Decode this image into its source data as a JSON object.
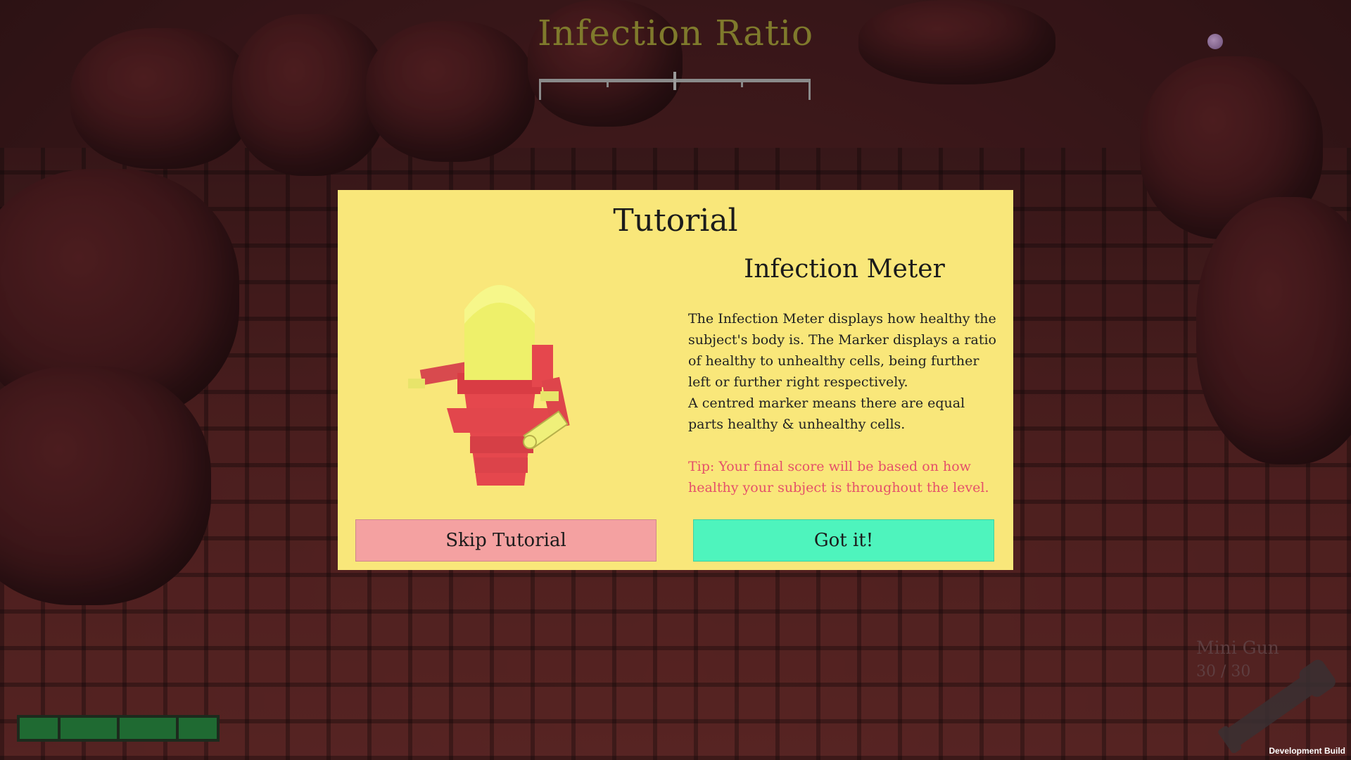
{
  "hud": {
    "infection_title": "Infection Ratio",
    "meter_marker_fraction": 0.5
  },
  "tutorial": {
    "title": "Tutorial",
    "section_title": "Infection Meter",
    "body_lines": [
      "The Infection Meter displays how healthy the subject's body is. The Marker displays a ratio of healthy to unhealthy cells, being further left or further right respectively.",
      "A centred marker means there are equal parts healthy & unhealthy cells."
    ],
    "tip": "Tip: Your final score will be based on how healthy your subject is throughout the level.",
    "skip_label": "Skip Tutorial",
    "ok_label": "Got it!"
  },
  "weapon": {
    "name": "Mini Gun",
    "ammo": "30 / 30",
    "icon": "minigun-icon"
  },
  "health": {
    "segments": 4
  },
  "footer": {
    "dev_build": "Development Build"
  },
  "colors": {
    "modal_bg": "#f9e77a",
    "skip_button": "#f4a1a1",
    "ok_button": "#4ef4bd",
    "tip_text": "#e4506a",
    "health_green": "#1f6a32"
  }
}
